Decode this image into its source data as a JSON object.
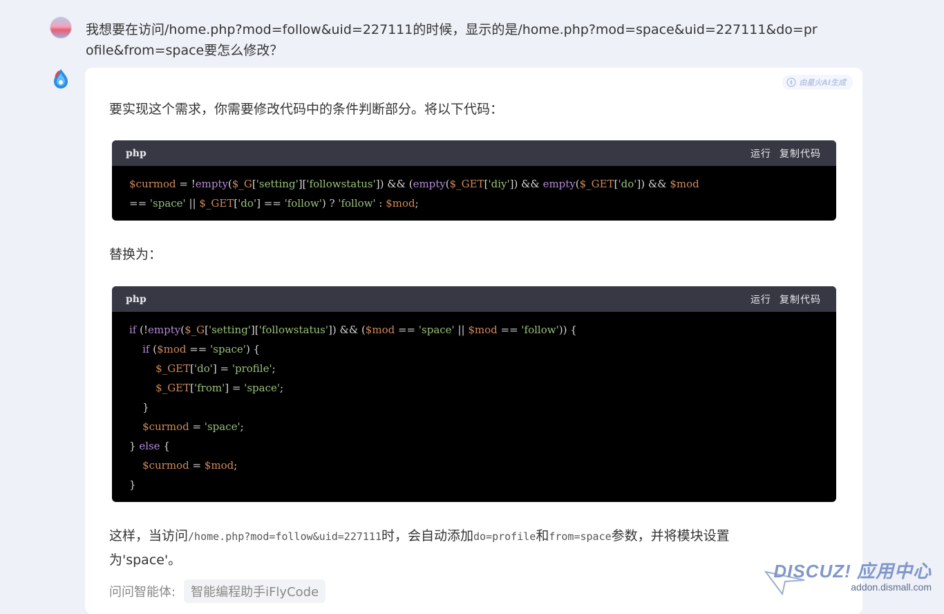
{
  "question": "我想要在访问/home.php?mod=follow&uid=227111的时候，显示的是/home.php?mod=space&uid=227111&do=profile&from=space要怎么修改？",
  "ai_badge": "由星火AI生成",
  "answer": {
    "intro": "要实现这个需求，你需要修改代码中的条件判断部分。将以下代码：",
    "replace_label": "替换为：",
    "outro_prefix": "这样，当访问",
    "outro_code1": "/home.php?mod=follow&uid=227111",
    "outro_mid1": "时，会自动添加",
    "outro_code2": "do=profile",
    "outro_mid2": "和",
    "outro_code3": "from=space",
    "outro_suffix": "参数，并将模块设置为'space'。"
  },
  "code_blocks": [
    {
      "lang": "php",
      "run_label": "运行",
      "copy_label": "复制代码"
    },
    {
      "lang": "php",
      "run_label": "运行",
      "copy_label": "复制代码"
    }
  ],
  "agent": {
    "label": "问问智能体:",
    "chip": "智能编程助手iFlyCode"
  },
  "watermark": {
    "main": "DISCUZ! 应用中心",
    "sub": "addon.dismall.com"
  },
  "colors": {
    "code_bg": "#000000",
    "code_header": "#373843",
    "keyword": "#b58ad6",
    "variable": "#d08a5b",
    "string": "#9bc27b"
  }
}
